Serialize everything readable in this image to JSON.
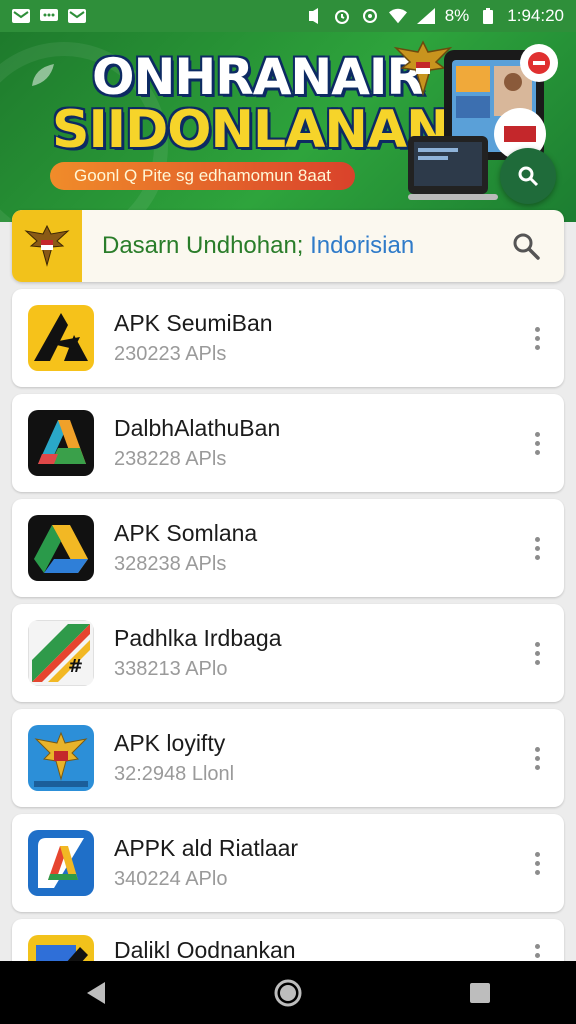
{
  "status_bar": {
    "left_icons": [
      "mail-icon",
      "message-icon",
      "mail-icon"
    ],
    "right_icons": [
      "mute-icon",
      "alarm-icon",
      "sync-icon",
      "wifi-icon",
      "signal-icon"
    ],
    "battery": "8%",
    "time": "1:94:20"
  },
  "banner": {
    "title_line1": "ONHRANAIR",
    "title_line2": "SIIDONLANAN",
    "tagline": "Goonl Q Pite sg edhamomun 8aat",
    "colors": {
      "primary": "#2ea43c",
      "accent_yellow": "#f6d42a",
      "pill": "#e8672a"
    }
  },
  "search": {
    "text_main": "Dasarn Undhohan; ",
    "text_highlight": "Indorisian"
  },
  "apps": [
    {
      "name": "APK SeumiBan",
      "meta": "230223 APls",
      "icon": "app-icon-yellow-a"
    },
    {
      "name": "DalbhAlathuBan",
      "meta": "238228 APls",
      "icon": "app-icon-triangle"
    },
    {
      "name": "APK Somlana",
      "meta": "328238 APls",
      "icon": "app-icon-drive"
    },
    {
      "name": "Padhlka Irdbaga",
      "meta": "338213 APlo",
      "icon": "app-icon-stripes"
    },
    {
      "name": "APK loyifty",
      "meta": "32:2948 Llonl",
      "icon": "app-icon-garuda"
    },
    {
      "name": "APPK ald Riatlaar",
      "meta": "340224 APlo",
      "icon": "app-icon-blue-a"
    },
    {
      "name": "Dalikl Oodnankan",
      "meta": "",
      "icon": "app-icon-yellow-edit"
    }
  ],
  "nav": {
    "buttons": [
      "back-icon",
      "home-icon",
      "recents-icon"
    ]
  }
}
